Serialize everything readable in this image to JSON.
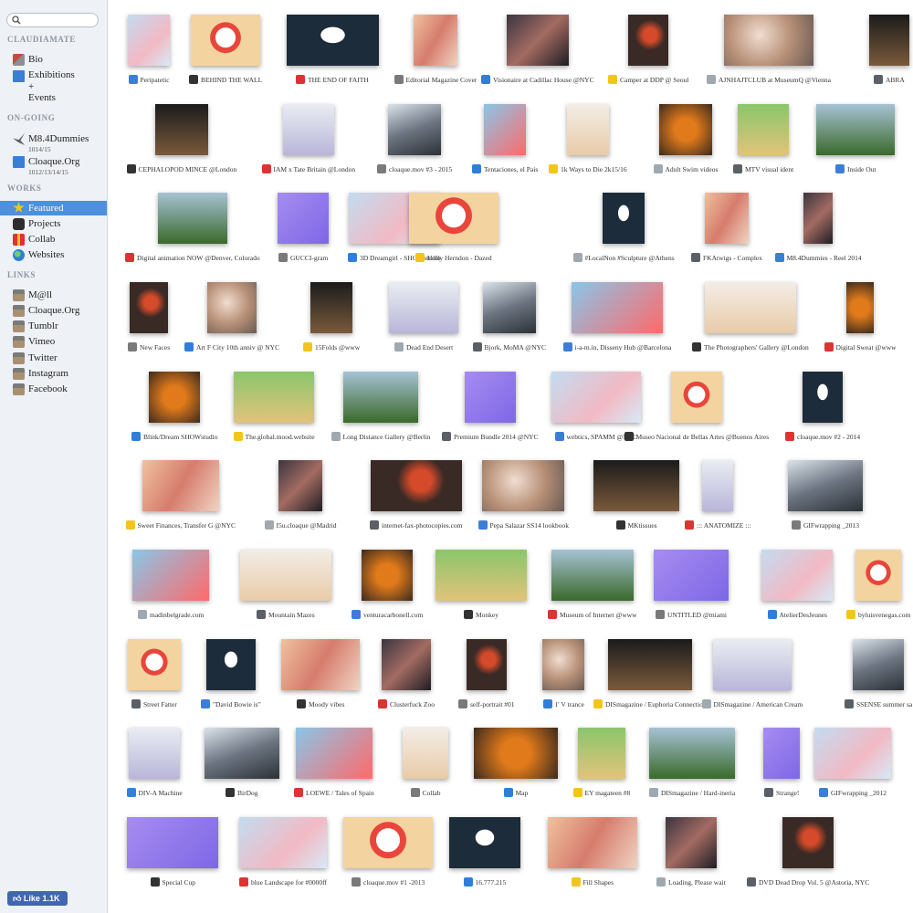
{
  "sidebar": {
    "search_placeholder": "",
    "site_title": "CLAUDIAMATE",
    "items_top": [
      {
        "label": "Bio",
        "icon": "cube-icon"
      },
      {
        "label": "Exhibitions\n+\nEvents",
        "icon": "doc-icon"
      }
    ],
    "ongoing_title": "ON-GOING",
    "ongoing": [
      {
        "label": "M8.4Dummies",
        "sub": "1014/15",
        "icon": "bird-icon"
      },
      {
        "label": "Cloaque.Org",
        "sub": "1012/13/14/15",
        "icon": "doc-icon"
      }
    ],
    "works_title": "WORKS",
    "works": [
      {
        "label": "Featured",
        "icon": "star-icon"
      },
      {
        "label": "Projects",
        "icon": "dark-cube-icon"
      },
      {
        "label": "Collab",
        "icon": "gift-icon"
      },
      {
        "label": "Websites",
        "icon": "globe-icon"
      }
    ],
    "links_title": "LINKS",
    "links": [
      {
        "label": "M@ll",
        "icon": "chest-icon"
      },
      {
        "label": "Cloaque.Org",
        "icon": "chest-icon"
      },
      {
        "label": "Tumblr",
        "icon": "chest-icon"
      },
      {
        "label": "Vimeo",
        "icon": "chest-icon"
      },
      {
        "label": "Twitter",
        "icon": "chest-icon"
      },
      {
        "label": "Instagram",
        "icon": "chest-icon"
      },
      {
        "label": "Facebook",
        "icon": "chest-icon"
      }
    ],
    "like_label": "Like",
    "like_count": "1.1K"
  },
  "colors": {
    "sidebar_bg": "#eef1f5",
    "active_bg": "#4d90dc",
    "facebook": "#4267b2"
  },
  "grid": [
    [
      "Peripatetic",
      "BEHIND THE WALL",
      "THE END OF FAITH",
      "Editorial Magazine Cover",
      "Visionaire at Cadillac House @NYC",
      "Camper at DDP @ Seoul",
      "AJNHAJTCLUB at MuseumQ @Vienna",
      "ABRA"
    ],
    [
      "CEPHALOPOD MINCE @London",
      "IAM x Tate Britain @London",
      "cloaque.mov #3 - 2015",
      "Tentaciones, el Pais",
      "1k Ways to Die 2k15/16",
      "Adult Swim videos",
      "MTV visual ident",
      "Inside Out"
    ],
    [
      "Digital animation NOW @Denver, Colorado",
      "GUCCI-gram",
      "3D Dreamgirl - SHOWstudio",
      "Holly Herndon - Dazed",
      "#LocalNon #Sculpture @Athens",
      "FKAtwigs - Complex",
      "M8.4Dummies - Reel 2014"
    ],
    [
      "New Faces",
      "Art F City 10th anniv @ NYC",
      "15Folds @www",
      "Dead End Desert",
      "Bjork, MoMA @NYC",
      "i-a-m.in, Disseny Hub @Barcelona",
      "The Photographers' Gallery @London",
      "Digital Sweat @www"
    ],
    [
      "Blink/Dream SHOWstudio",
      "The.global.mood.website",
      "Long Distance Gallery @Berlin",
      "Premium Bundle 2014 @NYC",
      "webtics, SPAMM @NYC",
      "Museo Nacional de Bellas Artes @Buenos Aires",
      "cloaque.mov #2 - 2014"
    ],
    [
      "Sweet Finances, Transfer G @NYC",
      "I5u.cloaque @Madrid",
      "internet-fax-photocopies.com",
      "Pepa Salazar SS14 lookbook",
      "MKtissues",
      "::: ANATOMIZE :::",
      "GIFwrapping _2013"
    ],
    [
      "madinbelgrade.com",
      "Mountain Mazes",
      "venturacarbonell.com",
      "Monkey",
      "Museum of Internet @www",
      "UNTITLED @miami",
      "AtelierDesJeunes",
      "byluisvenegas.com"
    ],
    [
      "Street Fatter",
      "\"David Bowie is\"",
      "Moody vibes",
      "Clusterfuck Zoo",
      "self-portrait #01",
      "1' V trance",
      "DISmagazine / Euphoria Connection",
      "DISmagazine / American Cream",
      "SSENSE summer sa"
    ],
    [
      "DIV-A Machine",
      "BirDog",
      "LOEWE / Tales of Spain",
      "Collab",
      "Map",
      "EY magateen #8",
      "DISmagazine / Hard-ineria",
      "Strange!",
      "GIFwrapping _2012"
    ],
    [
      "Special Cup",
      "blue Landscape for #0000ff",
      "cloaque.mov #1 -2013",
      "16.777.215",
      "Fill Shapes",
      "Loading, Please wait",
      "DVD Dead Drop Vol. 5 @Astoria, NYC"
    ]
  ]
}
